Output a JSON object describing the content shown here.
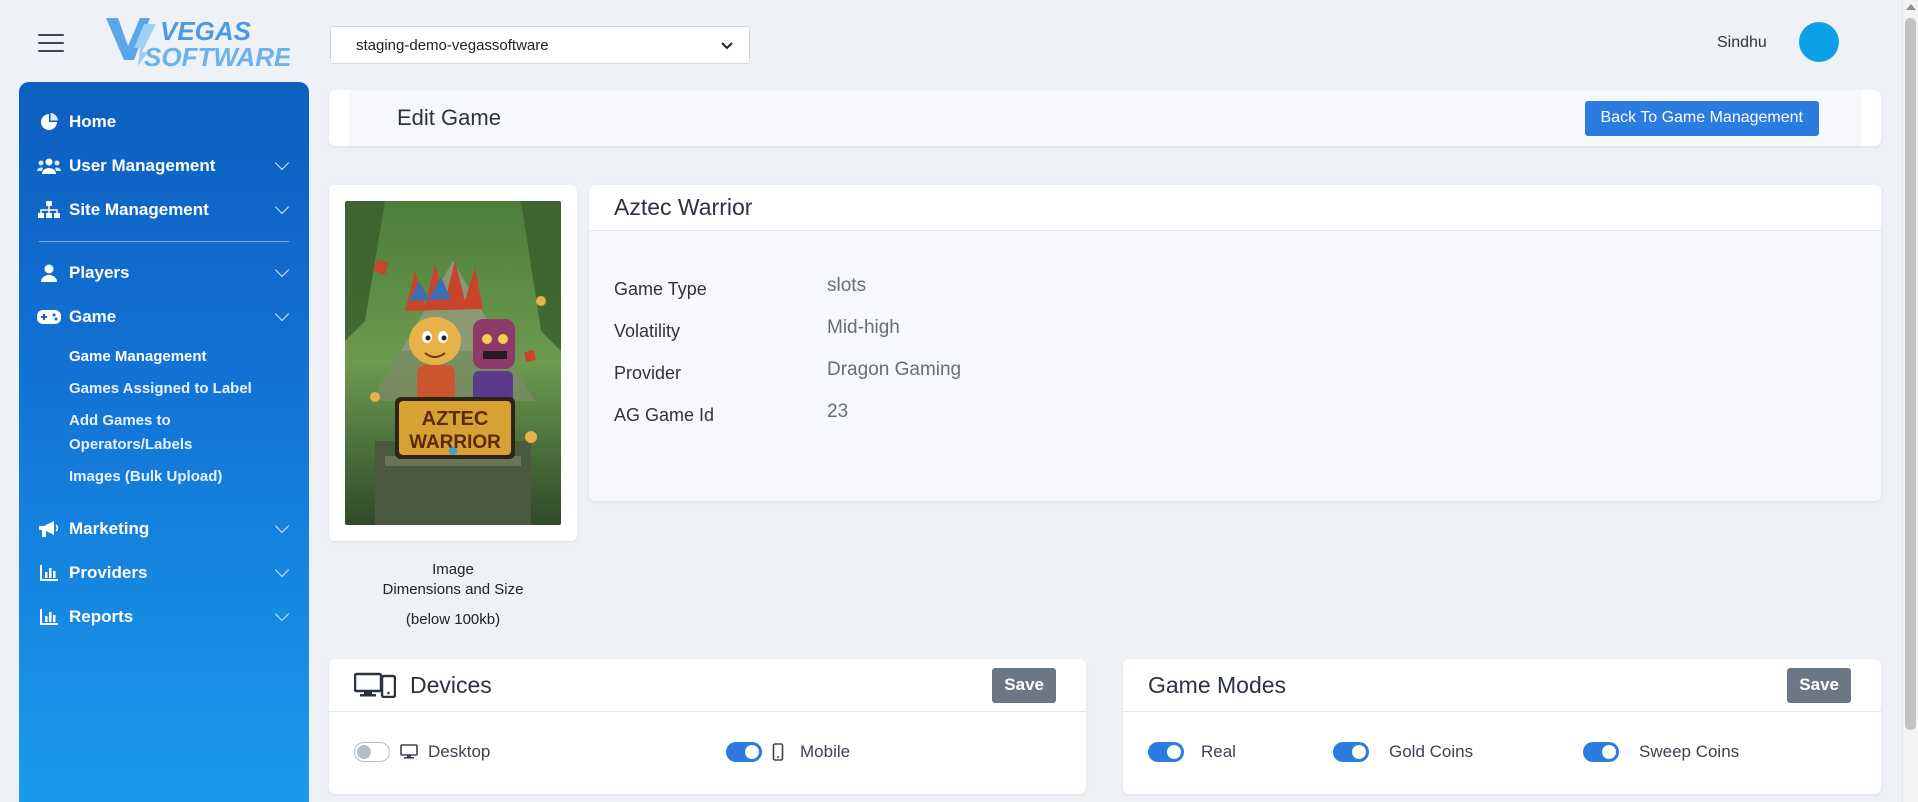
{
  "topbar": {
    "logo_text_line1": "VEGAS",
    "logo_text_line2": "SOFTWARE",
    "site_selected": "staging-demo-vegassoftware",
    "username": "Sindhu"
  },
  "sidebar": {
    "items": [
      {
        "label": "Home",
        "icon": "pie-chart-icon"
      },
      {
        "label": "User Management",
        "icon": "users-icon"
      },
      {
        "label": "Site Management",
        "icon": "sitemap-icon"
      },
      {
        "label": "Players",
        "icon": "user-icon"
      },
      {
        "label": "Game",
        "icon": "gamepad-icon"
      },
      {
        "label": "Marketing",
        "icon": "megaphone-icon"
      },
      {
        "label": "Providers",
        "icon": "bar-chart-icon"
      },
      {
        "label": "Reports",
        "icon": "bar-chart-icon"
      }
    ],
    "game_subitems": [
      "Game Management",
      "Games Assigned to Label",
      "Add Games to Operators/Labels",
      "Images (Bulk Upload)"
    ]
  },
  "header": {
    "title": "Edit Game",
    "back_button": "Back To Game Management"
  },
  "image_panel": {
    "art_title_line1": "AZTEC",
    "art_title_line2": "WARRIOR",
    "caption_line1": "Image",
    "caption_line2": "Dimensions and Size",
    "caption_line3": "(below 100kb)"
  },
  "game": {
    "name": "Aztec Warrior",
    "fields": [
      {
        "label": "Game Type",
        "value": "slots"
      },
      {
        "label": "Volatility",
        "value": "Mid-high"
      },
      {
        "label": "Provider",
        "value": "Dragon Gaming"
      },
      {
        "label": "AG Game Id",
        "value": "23"
      }
    ]
  },
  "devices": {
    "title": "Devices",
    "save_label": "Save",
    "desktop_label": "Desktop",
    "desktop_enabled": false,
    "mobile_label": "Mobile",
    "mobile_enabled": true
  },
  "modes": {
    "title": "Game Modes",
    "save_label": "Save",
    "real_label": "Real",
    "real_enabled": true,
    "gold_label": "Gold Coins",
    "gold_enabled": true,
    "sweep_label": "Sweep Coins",
    "sweep_enabled": true
  },
  "colors": {
    "accent": "#2b7be0",
    "sidebar_top": "#0d5fbd",
    "sidebar_bottom": "#1a9ceb",
    "avatar": "#0ea0e6",
    "save_button": "#6c7685"
  }
}
